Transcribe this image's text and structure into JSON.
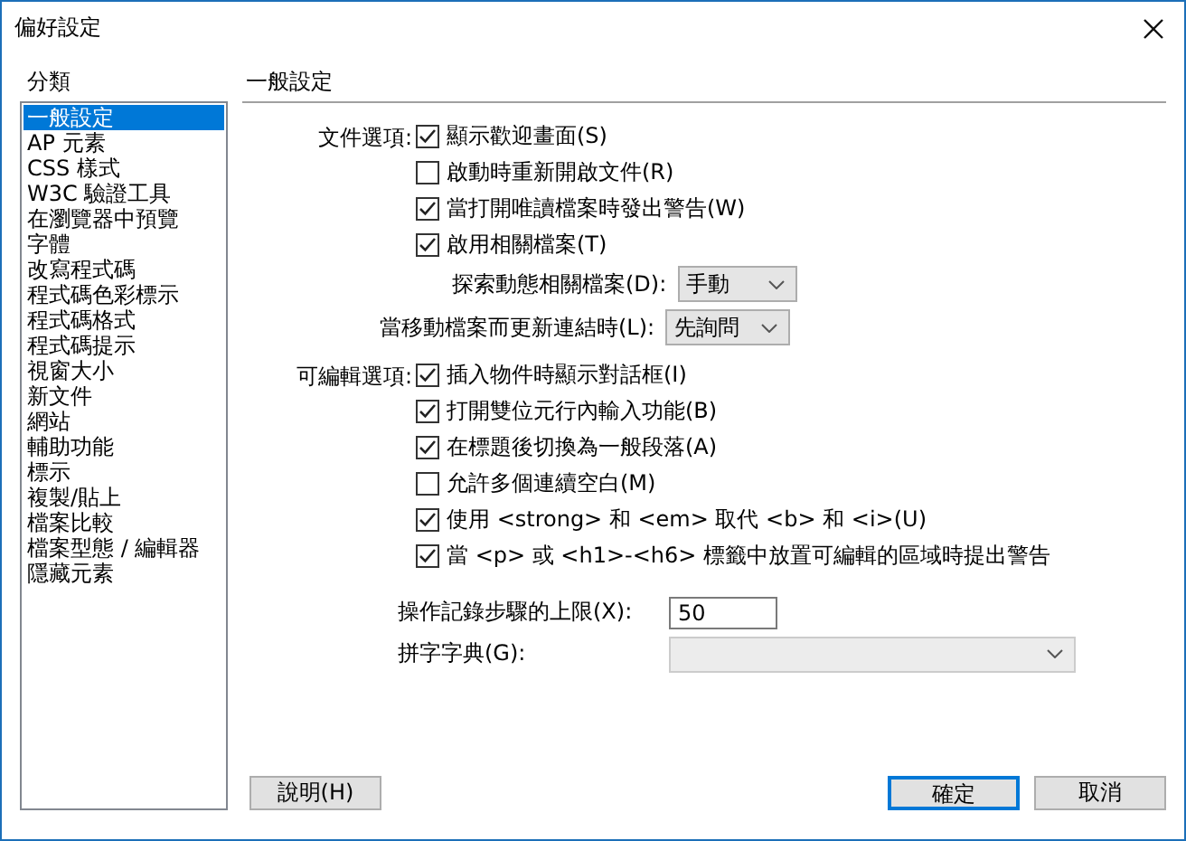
{
  "window": {
    "title": "偏好設定"
  },
  "sidebar": {
    "label": "分類",
    "items": [
      {
        "label": "一般設定",
        "selected": true
      },
      {
        "label": "AP 元素",
        "selected": false
      },
      {
        "label": "CSS 樣式",
        "selected": false
      },
      {
        "label": "W3C 驗證工具",
        "selected": false
      },
      {
        "label": "在瀏覽器中預覽",
        "selected": false
      },
      {
        "label": "字體",
        "selected": false
      },
      {
        "label": "改寫程式碼",
        "selected": false
      },
      {
        "label": "程式碼色彩標示",
        "selected": false
      },
      {
        "label": "程式碼格式",
        "selected": false
      },
      {
        "label": "程式碼提示",
        "selected": false
      },
      {
        "label": "視窗大小",
        "selected": false
      },
      {
        "label": "新文件",
        "selected": false
      },
      {
        "label": "網站",
        "selected": false
      },
      {
        "label": "輔助功能",
        "selected": false
      },
      {
        "label": "標示",
        "selected": false
      },
      {
        "label": "複製/貼上",
        "selected": false
      },
      {
        "label": "檔案比較",
        "selected": false
      },
      {
        "label": "檔案型態 / 編輯器",
        "selected": false
      },
      {
        "label": "隱藏元素",
        "selected": false
      }
    ]
  },
  "panel": {
    "title": "一般設定",
    "groups": [
      {
        "label": "文件選項:",
        "rows": [
          {
            "kind": "checkbox",
            "label": "顯示歡迎畫面(S)",
            "checked": true
          },
          {
            "kind": "checkbox",
            "label": "啟動時重新開啟文件(R)",
            "checked": false
          },
          {
            "kind": "checkbox",
            "label": "當打開唯讀檔案時發出警告(W)",
            "checked": true
          },
          {
            "kind": "checkbox",
            "label": "啟用相關檔案(T)",
            "checked": true
          },
          {
            "kind": "dropdown",
            "label": "探索動態相關檔案(D):",
            "value": "手動",
            "nested": true
          },
          {
            "kind": "dropdown",
            "label": "當移動檔案而更新連結時(L):",
            "value": "先詢問",
            "nested": false
          }
        ]
      },
      {
        "label": "可編輯選項:",
        "rows": [
          {
            "kind": "checkbox",
            "label": "插入物件時顯示對話框(I)",
            "checked": true
          },
          {
            "kind": "checkbox",
            "label": "打開雙位元行內輸入功能(B)",
            "checked": true
          },
          {
            "kind": "checkbox",
            "label": "在標題後切換為一般段落(A)",
            "checked": true
          },
          {
            "kind": "checkbox",
            "label": "允許多個連續空白(M)",
            "checked": false
          },
          {
            "kind": "checkbox",
            "label": "使用 <strong> 和 <em> 取代 <b> 和 <i>(U)",
            "checked": true
          },
          {
            "kind": "checkbox",
            "label": "當 <p> 或 <h1>-<h6> 標籤中放置可編輯的區域時提出警告",
            "checked": true
          }
        ]
      }
    ],
    "fields": [
      {
        "kind": "text",
        "label": "操作記錄步驟的上限(X):",
        "value": "50"
      },
      {
        "kind": "select",
        "label": "拼字字典(G):",
        "disabled": true
      }
    ]
  },
  "buttons": [
    {
      "label": "說明(H)",
      "default": false
    },
    {
      "label": "確定",
      "default": true
    },
    {
      "label": "取消",
      "default": false
    }
  ]
}
